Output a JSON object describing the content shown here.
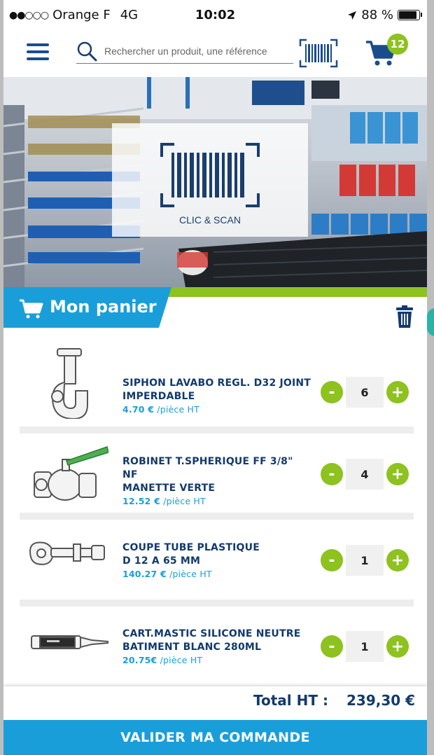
{
  "status_bar": {
    "signal_dots": "●●○○○",
    "carrier": "Orange F",
    "network": "4G",
    "time": "10:02",
    "battery_percent": "88 %",
    "battery_level": 0.88
  },
  "header": {
    "search_placeholder": "Rechercher un produit, une référence",
    "cart_count": "12"
  },
  "hero": {
    "scan_label": "CLIC & SCAN"
  },
  "cart": {
    "title": "Mon panier",
    "items": [
      {
        "name_line1": "SIPHON LAVABO REGL. D32 JOINT",
        "name_line2": "IMPERDABLE",
        "price": "4.70 €",
        "unit": "/pièce HT",
        "quantity": "6",
        "icon": "siphon-icon"
      },
      {
        "name_line1": "ROBINET T.SPHERIQUE FF 3/8\" NF",
        "name_line2": "MANETTE VERTE",
        "price": "12.52 €",
        "unit": "/pièce HT",
        "quantity": "4",
        "icon": "ball-valve-icon"
      },
      {
        "name_line1": "COUPE TUBE PLASTIQUE",
        "name_line2": "D 12 A 65 MM",
        "price": "140.27 €",
        "unit": "/pièce HT",
        "quantity": "1",
        "icon": "pipe-cutter-icon"
      },
      {
        "name_line1": "CART.MASTIC SILICONE NEUTRE",
        "name_line2": "BATIMENT BLANC 280ML",
        "price": "20.75€",
        "unit": "/pièce HT",
        "quantity": "1",
        "icon": "silicone-cartridge-icon"
      }
    ],
    "minus_label": "-",
    "plus_label": "+",
    "total_label": "Total HT :",
    "total_value": "239,30 €",
    "validate_label": "VALIDER MA COMMANDE"
  },
  "colors": {
    "brand_blue": "#1a9ed9",
    "navy": "#123a6d",
    "accent_green": "#8dc21f"
  }
}
